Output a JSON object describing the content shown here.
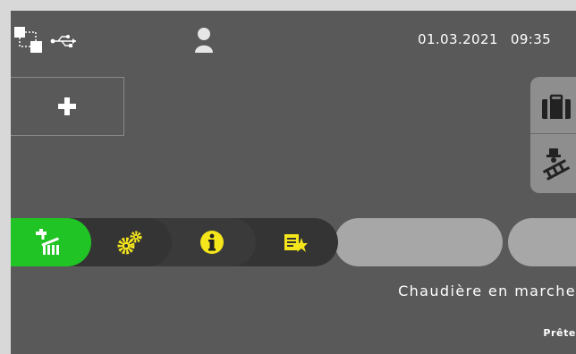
{
  "status_bar": {
    "date": "01.03.2021",
    "time": "09:35",
    "icons": [
      "network-icon",
      "usb-icon",
      "user-icon"
    ]
  },
  "widgets": {
    "add_icon": "plus-icon"
  },
  "side_panel": {
    "buttons": [
      "suitcase-icon",
      "chimney-sweep-icon"
    ]
  },
  "tabs": [
    {
      "icon": "heating-tap-radiator-icon",
      "active": true,
      "color": "#21c425"
    },
    {
      "icon": "gears-icon",
      "active": false,
      "color": "#f5e51b"
    },
    {
      "icon": "info-icon",
      "active": false,
      "color": "#f5e51b"
    },
    {
      "icon": "notes-star-icon",
      "active": false,
      "color": "#f5e51b"
    }
  ],
  "status": {
    "main": "Chaudière en marche",
    "sub": "Prête"
  },
  "colors": {
    "screen_bg": "#595959",
    "active_tab": "#21c425",
    "accent_yellow": "#f5e51b",
    "panel": "#8e8e8e"
  }
}
